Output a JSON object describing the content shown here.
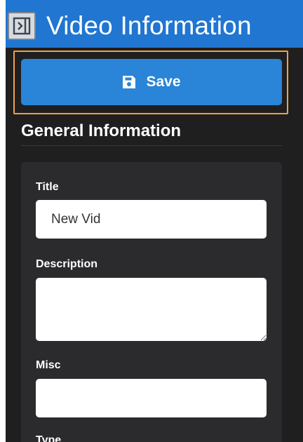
{
  "header": {
    "title": "Video Information",
    "collapse_icon": "panel-collapse-icon"
  },
  "toolbar": {
    "save_label": "Save",
    "save_icon": "floppy-disk-icon"
  },
  "section": {
    "title": "General Information"
  },
  "form": {
    "title_label": "Title",
    "title_value": "New Vid",
    "description_label": "Description",
    "description_value": "",
    "misc_label": "Misc",
    "misc_value": "",
    "type_label": "Type"
  },
  "colors": {
    "header_bg": "#2076d0",
    "save_bg": "#2a84d7",
    "panel_bg": "#1f1f20",
    "card_bg": "#2b2b2d",
    "focus_outline": "#f0a04b"
  }
}
